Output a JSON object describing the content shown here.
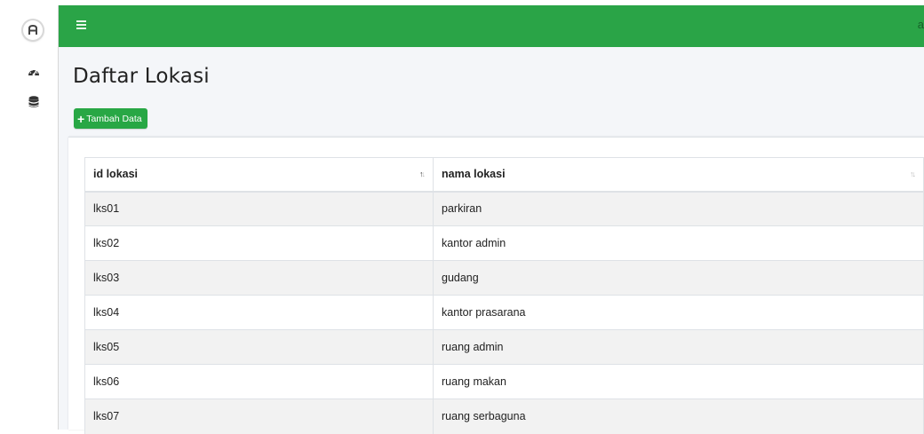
{
  "navbar": {
    "right_text": "a"
  },
  "page": {
    "title": "Daftar Lokasi"
  },
  "toolbar": {
    "add_label": "Tambah Data"
  },
  "table": {
    "columns": [
      "id lokasi",
      "nama lokasi"
    ],
    "rows": [
      [
        "lks01",
        "parkiran"
      ],
      [
        "lks02",
        "kantor admin"
      ],
      [
        "lks03",
        "gudang"
      ],
      [
        "lks04",
        "kantor prasarana"
      ],
      [
        "lks05",
        "ruang admin"
      ],
      [
        "lks06",
        "ruang makan"
      ],
      [
        "lks07",
        "ruang serbaguna"
      ]
    ]
  },
  "colors": {
    "navbar": "#2aa447",
    "button": "#28a745"
  },
  "icons": {
    "brand": "brand-logo-icon",
    "sidebar": [
      "dashboard-icon",
      "database-icon"
    ],
    "menu": "hamburger-icon"
  }
}
